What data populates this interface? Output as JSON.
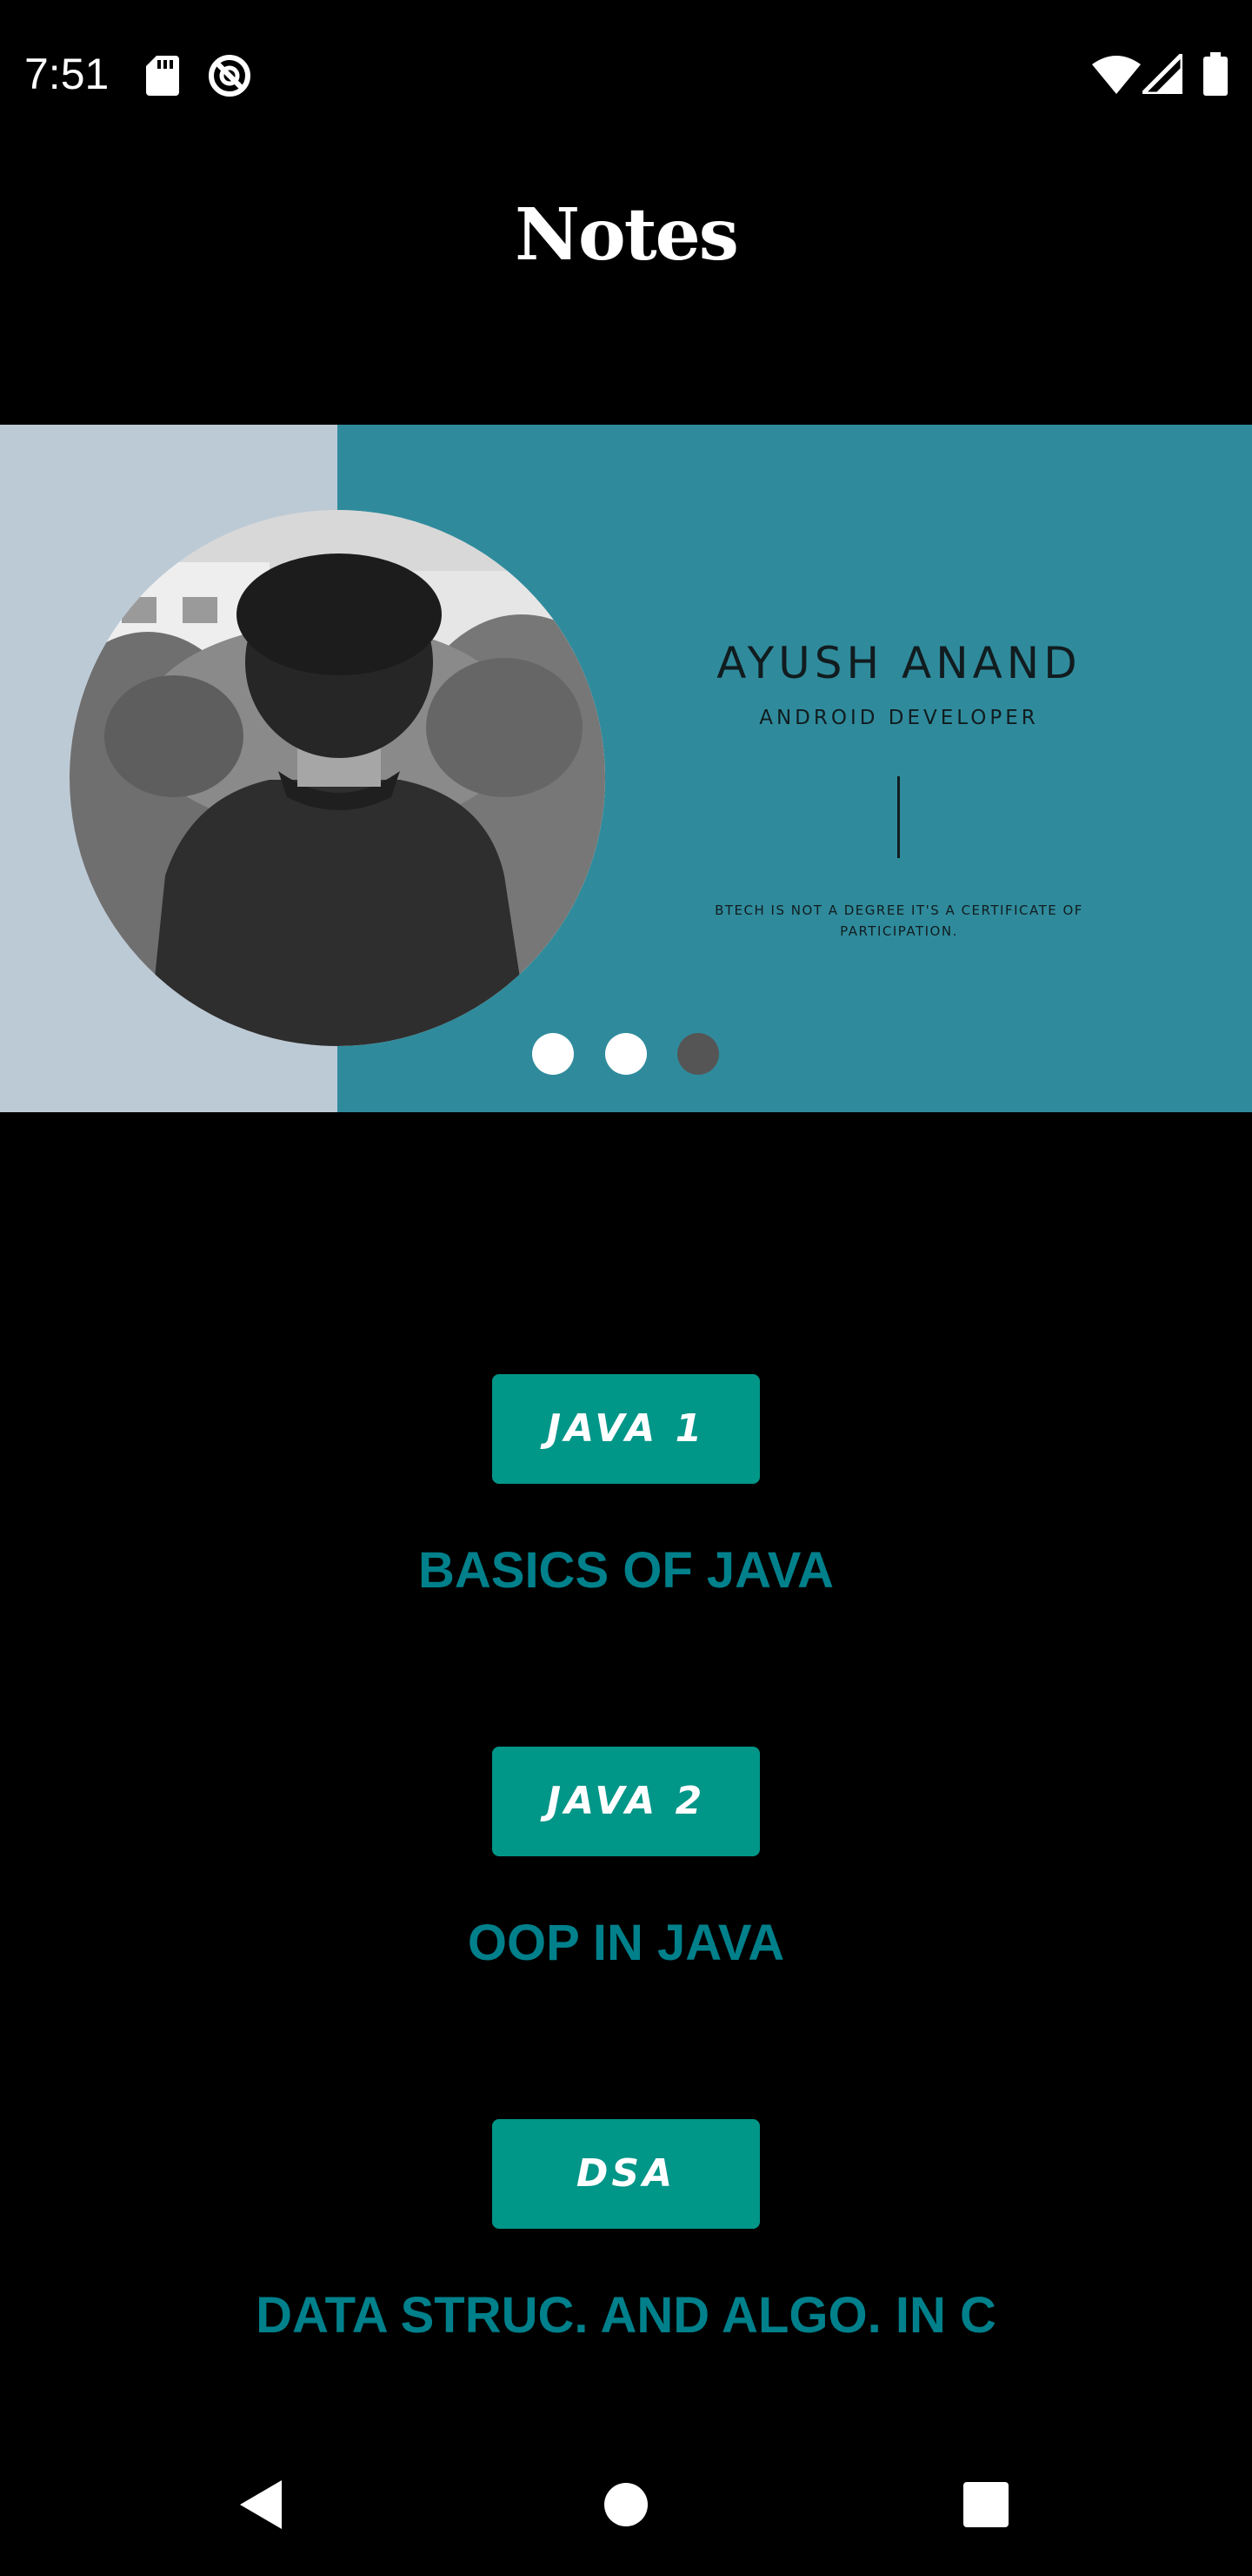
{
  "status_bar": {
    "time": "7:51",
    "left_icons": [
      "sd-card-icon",
      "do-not-disturb-icon"
    ],
    "right_icons": [
      "wifi-icon",
      "cell-signal-icon",
      "battery-icon"
    ]
  },
  "app_bar": {
    "title": "Notes"
  },
  "carousel": {
    "slide": {
      "name": "AYUSH ANAND",
      "role": "ANDROID DEVELOPER",
      "quote_line1": "BTECH IS NOT A DEGREE IT'S A CERTIFICATE OF",
      "quote_line2": "PARTICIPATION."
    },
    "indicator_count": 3,
    "active_indicator": 3,
    "colors": {
      "left_panel": "#bccad6",
      "right_panel": "#2f8b9c"
    }
  },
  "notes": [
    {
      "button_label": "JAVA 1",
      "caption": "BASICS OF JAVA"
    },
    {
      "button_label": "JAVA 2",
      "caption": "OOP IN JAVA"
    },
    {
      "button_label": "DSA",
      "caption": "DATA STRUC. AND ALGO. IN C"
    }
  ],
  "colors": {
    "button": "#009688",
    "caption": "#00808b",
    "background": "#000000"
  },
  "nav_bar": {
    "icons": [
      "back-icon",
      "home-icon",
      "recents-icon"
    ]
  }
}
